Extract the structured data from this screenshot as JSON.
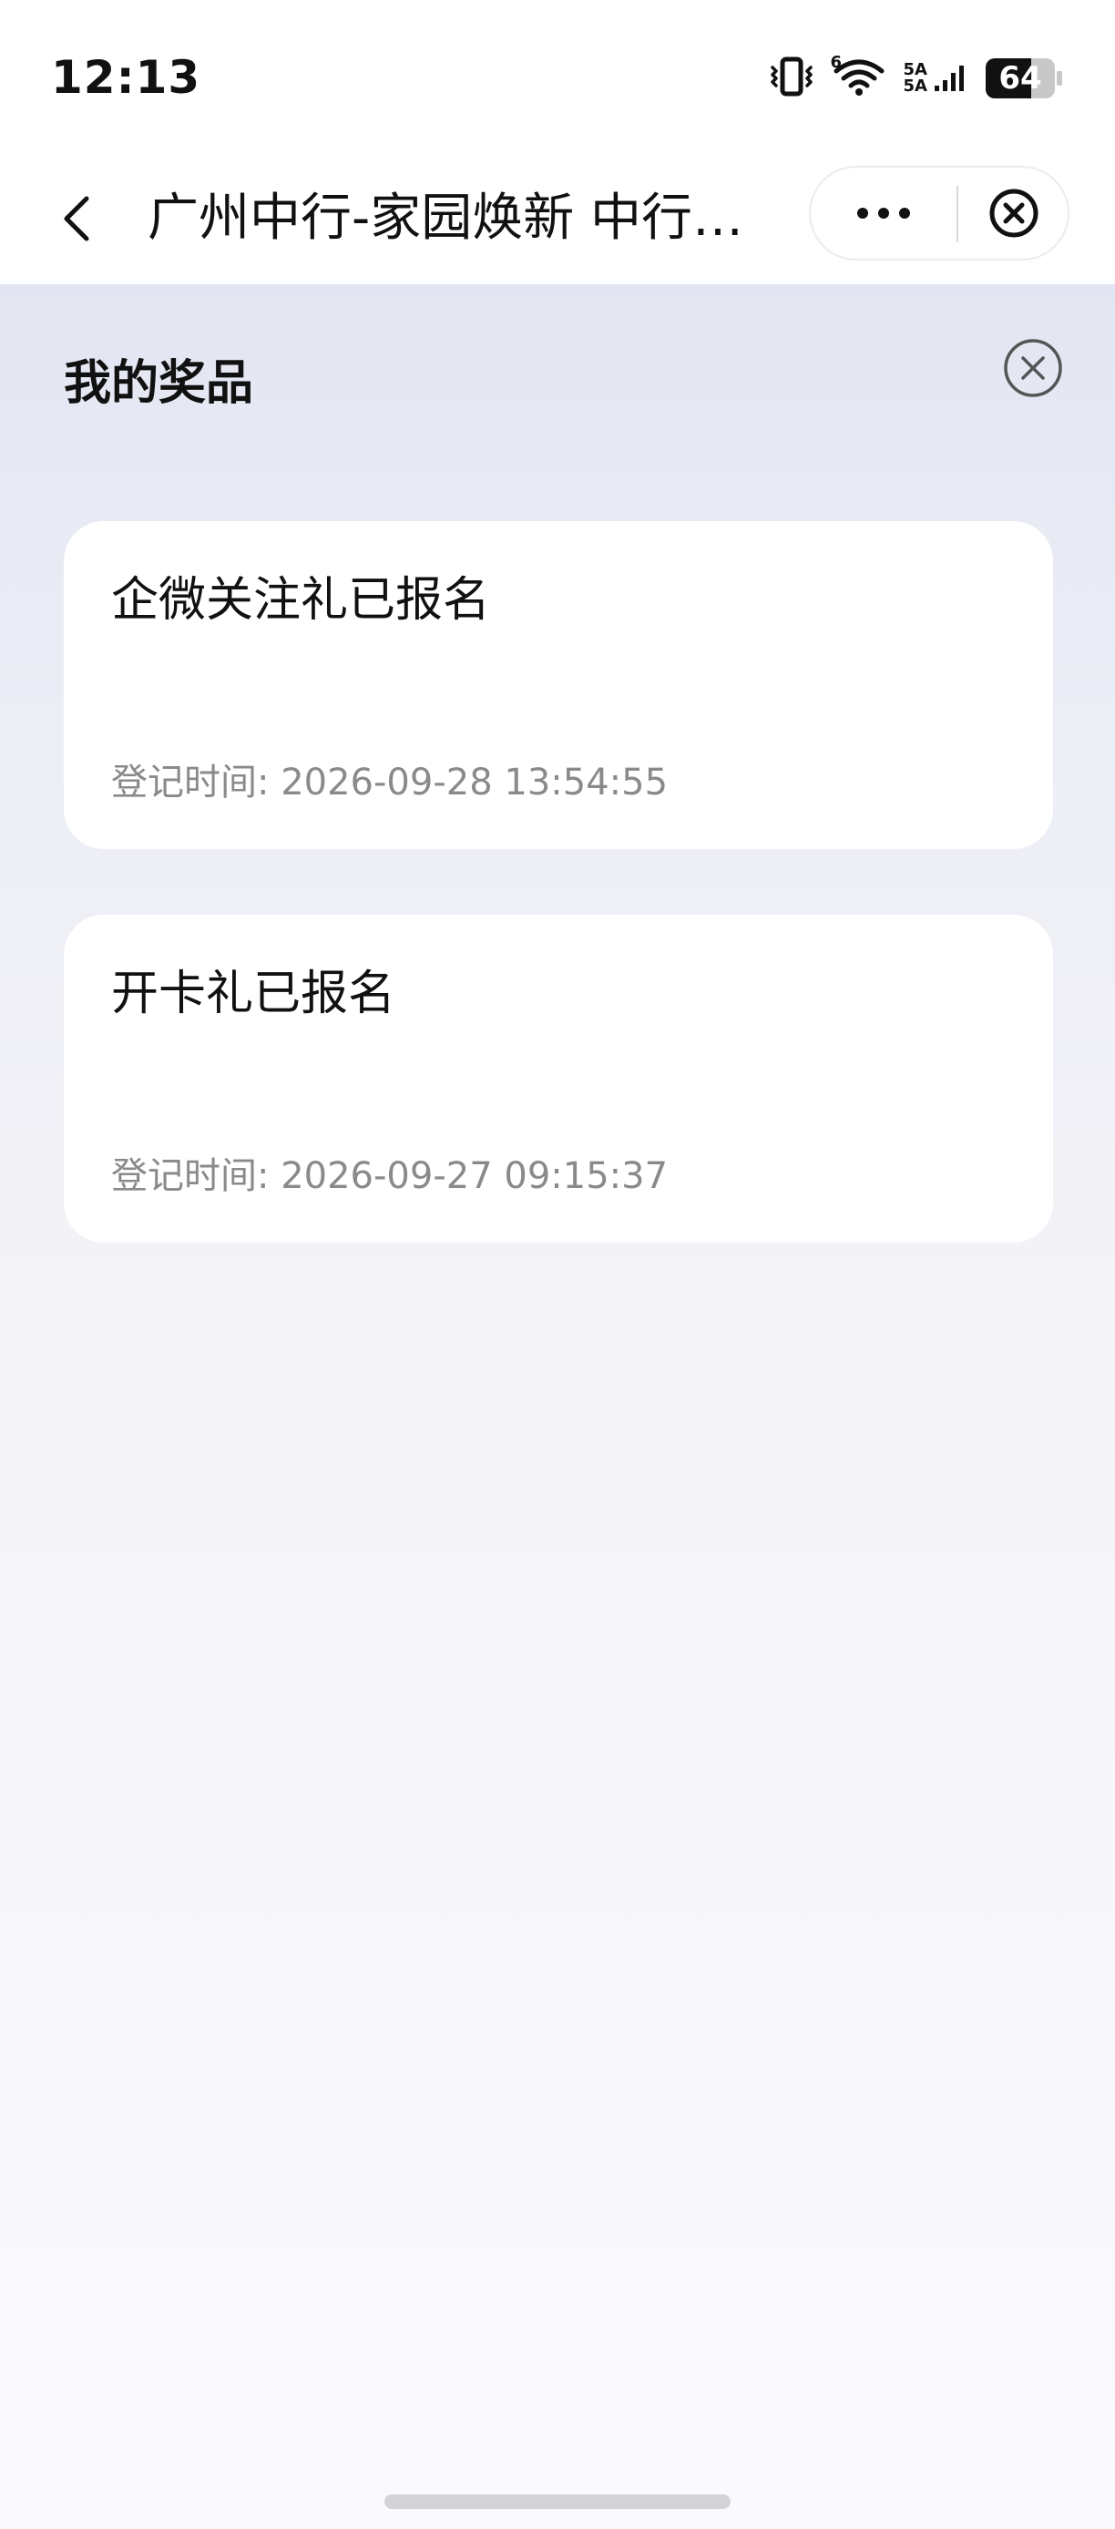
{
  "status_bar": {
    "time": "12:13",
    "network_label_top": "5A",
    "network_label_bottom": "5A",
    "wifi_badge": "6",
    "battery": "64"
  },
  "nav": {
    "title": "广州中行-家园焕新 中行…"
  },
  "page": {
    "title": "我的奖品"
  },
  "prizes": [
    {
      "name": "企微关注礼已报名",
      "time": "登记时间: 2026-09-28 13:54:55"
    },
    {
      "name": "开卡礼已报名",
      "time": "登记时间: 2026-09-27 09:15:37"
    }
  ]
}
